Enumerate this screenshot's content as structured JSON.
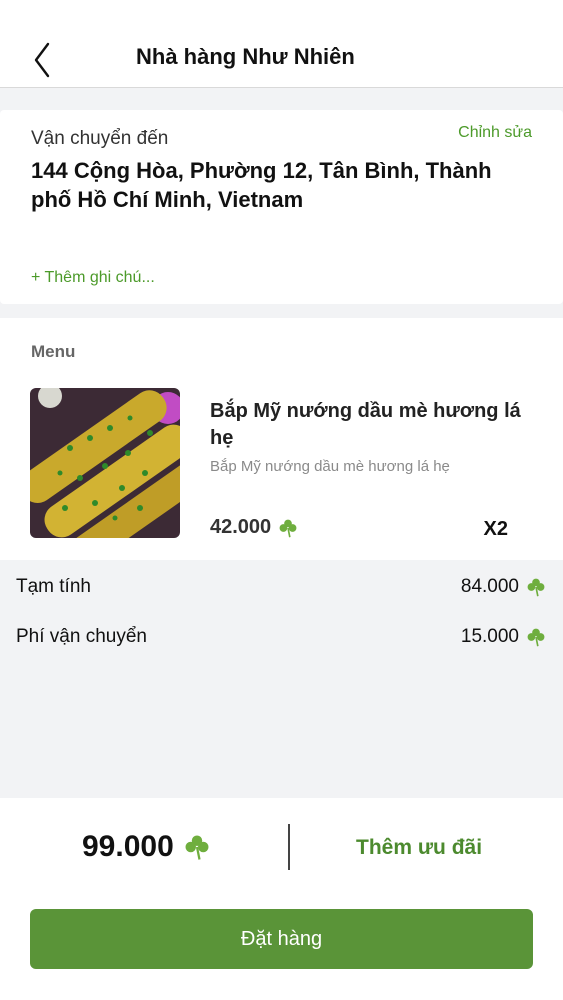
{
  "header": {
    "title": "Nhà hàng Như Nhiên",
    "back_icon": "chevron-left-icon"
  },
  "delivery": {
    "label": "Vận chuyển đến",
    "edit_label": "Chỉnh sửa",
    "address": "144 Cộng Hòa, Phường 12, Tân Bình, Thành phố Hồ Chí Minh, Vietnam",
    "add_note_label": "+ Thêm ghi chú..."
  },
  "menu": {
    "label": "Menu",
    "items": [
      {
        "name": "Bắp Mỹ nướng dầu mè hương lá hẹ",
        "description": "Bắp Mỹ nướng dầu mè hương lá hẹ",
        "price": "42.000",
        "quantity": "X2"
      }
    ]
  },
  "summary": {
    "subtotal_label": "Tạm tính",
    "subtotal_value": "84.000",
    "shipping_label": "Phí vận chuyển",
    "shipping_value": "15.000"
  },
  "footer": {
    "total": "99.000",
    "promo_label": "Thêm ưu đãi",
    "order_button": "Đặt hàng"
  },
  "colors": {
    "accent": "#5a9438",
    "link": "#4c9a2a"
  },
  "currency_icon": "clover-icon"
}
